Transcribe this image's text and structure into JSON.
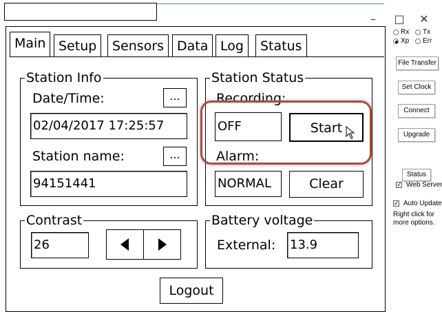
{
  "window": {
    "title": "",
    "minimize": "–",
    "maximize": "□",
    "close": "✕"
  },
  "tabs": [
    {
      "label": "Main",
      "active": true
    },
    {
      "label": "Setup",
      "active": false
    },
    {
      "label": "Sensors",
      "active": false
    },
    {
      "label": "Data",
      "active": false
    },
    {
      "label": "Log",
      "active": false
    },
    {
      "label": "Status",
      "active": false
    }
  ],
  "station_info": {
    "legend": "Station Info",
    "datetime_label": "Date/Time:",
    "datetime_value": "02/04/2017 17:25:57",
    "name_label": "Station name:",
    "name_value": "94151441",
    "more_button": "..."
  },
  "station_status": {
    "legend": "Station Status",
    "recording_label": "Recording:",
    "recording_value": "OFF",
    "start_button": "Start",
    "alarm_label": "Alarm:",
    "alarm_value": "NORMAL",
    "clear_button": "Clear"
  },
  "contrast": {
    "legend": "Contrast",
    "value": "26"
  },
  "battery": {
    "legend": "Battery voltage",
    "external_label": "External:",
    "external_value": "13.9"
  },
  "logout_button": "Logout",
  "side_panel": {
    "radios": [
      {
        "label": "Rx",
        "checked": false
      },
      {
        "label": "Tx",
        "checked": false
      },
      {
        "label": "Xp",
        "checked": true
      },
      {
        "label": "Err",
        "checked": false
      }
    ],
    "buttons": {
      "file_transfer": "File Transfer",
      "set_clock": "Set Clock",
      "connect": "Connect",
      "upgrade": "Upgrade",
      "status": "Status"
    },
    "web_server": "Web Server",
    "auto_update": "Auto Update",
    "hint": "Right click for more options."
  },
  "colors": {
    "highlight": "#b0483a",
    "title_accent": "#2a9fb0"
  }
}
